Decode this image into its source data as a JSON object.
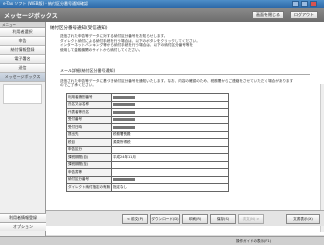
{
  "window": {
    "title": "e-Tax ソフト (WEB版) - 納付区分番号通知確認"
  },
  "app": {
    "title": "メッセージボックス",
    "buttons": [
      "画面を閉じる",
      "ログアウト"
    ]
  },
  "sidebar": {
    "header": "メニュー",
    "items": [
      "利用者選択",
      "申告",
      "納付情報登録",
      "電子署名",
      "送信",
      "メッセージボックス"
    ],
    "bottom_items": [
      "利用者情報登録",
      "オプション"
    ]
  },
  "main": {
    "doc_title": "納付区分番号通知(受信通知)",
    "intro_lines": [
      "送信された申告等データに対する納付区分番号をお知らせします。",
      "ダイレクト納付による納付手続を行う場合は、以下のボタンをクリックしてください。",
      "インターネットバンキング等から納付手続を行う場合は、以下の納付区分番号等を",
      "使用して金融機関のサイトから納付してください。"
    ],
    "subject": "メール詳細(納付区分番号通知)",
    "notice_lines": [
      "送信された申告等データに基づき納付区分番号を通知いたします。なお、内容の確認のため、税務署からご連絡をさせていただく場合があります",
      "のでご了承ください。"
    ],
    "table": [
      {
        "key": "利用者識別番号",
        "value": ""
      },
      {
        "key": "氏名又は名称",
        "value": ""
      },
      {
        "key": "代表者等氏名",
        "value": ""
      },
      {
        "key": "受付番号",
        "value": ""
      },
      {
        "key": "受付日時",
        "value": ""
      },
      {
        "key": "提出先",
        "value": "税務署長殿"
      },
      {
        "key": "税目",
        "value": "源泉所得税"
      },
      {
        "key": "申告区分",
        "value": ""
      },
      {
        "key": "課税期間(自)",
        "value": "平成24年11月"
      },
      {
        "key": "課税期間(至)",
        "value": ""
      },
      {
        "key": "申告書等",
        "value": ""
      },
      {
        "key": "納付区分番号",
        "value": ""
      },
      {
        "key": "ダイレクト納付指定の有無",
        "value": "指定なし"
      }
    ]
  },
  "actions": [
    "< 前文(P)",
    "ダウンロード(D)",
    "印刷(R)",
    "保存(S)",
    "次文(N) >",
    "文書表示(X)"
  ],
  "statusbar": {
    "left": "",
    "right": "操作ガイドの表示(F1)"
  }
}
